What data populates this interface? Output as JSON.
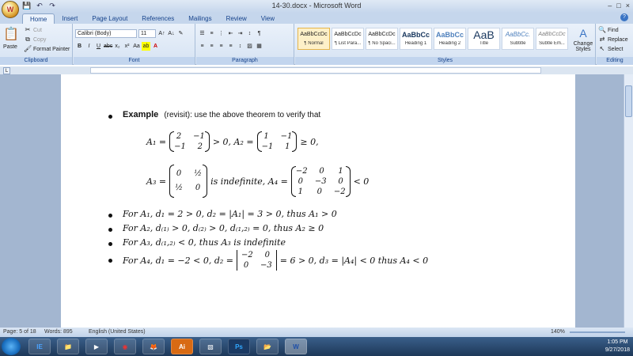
{
  "window": {
    "title": "14-30.docx - Microsoft Word",
    "controls": [
      "–",
      "□",
      "×"
    ]
  },
  "tabs": [
    "Home",
    "Insert",
    "Page Layout",
    "References",
    "Mailings",
    "Review",
    "View"
  ],
  "clipboard": {
    "paste": "Paste",
    "cut": "Cut",
    "copy": "Copy",
    "format_painter": "Format Painter",
    "label": "Clipboard"
  },
  "font": {
    "name": "Calibri (Body)",
    "size": "11",
    "label": "Font"
  },
  "paragraph": {
    "label": "Paragraph"
  },
  "styles": {
    "label": "Styles",
    "items": [
      {
        "preview": "AaBbCcDc",
        "name": "¶ Normal"
      },
      {
        "preview": "AaBbCcDc",
        "name": "¶ List Para..."
      },
      {
        "preview": "AaBbCcDc",
        "name": "¶ No Spaci..."
      },
      {
        "preview": "AaBbCc",
        "name": "Heading 1"
      },
      {
        "preview": "AaBbCc",
        "name": "Heading 2"
      },
      {
        "preview": "AaB",
        "name": "Title"
      },
      {
        "preview": "AaBbCc.",
        "name": "Subtitle"
      },
      {
        "preview": "AaBbCcDc",
        "name": "Subtle Em..."
      }
    ],
    "change_styles": "Change Styles"
  },
  "editing": {
    "find": "Find",
    "replace": "Replace",
    "select": "Select",
    "label": "Editing"
  },
  "doc": {
    "example_bold": "Example",
    "example_rest": "(revisit): use the above theorem to verify that",
    "a1_label": "A₁ =",
    "a1": [
      [
        "2",
        "−1"
      ],
      [
        "−1",
        "2"
      ]
    ],
    "a1_rel": "> 0, A₂ =",
    "a2": [
      [
        "1",
        "−1"
      ],
      [
        "−1",
        "1"
      ]
    ],
    "a2_rel": "≥ 0,",
    "a3_label": "A₃ =",
    "a3": [
      [
        "0",
        "½"
      ],
      [
        "½",
        "0"
      ]
    ],
    "a3_rel": "is indefinite, A₄ =",
    "a4": [
      [
        "−2",
        "0",
        "1"
      ],
      [
        "0",
        "−3",
        "0"
      ],
      [
        "1",
        "0",
        "−2"
      ]
    ],
    "a4_rel": "< 0",
    "bullets": [
      "For  A₁, d₁ = 2 > 0, d₂ = |A₁| = 3 > 0, thus A₁ > 0",
      "For  A₂, d₍₁₎ > 0, d₍₂₎ > 0, d₍₁,₂₎ = 0, thus A₂ ≥ 0",
      "For  A₃, d₍₁,₂₎ < 0, thus A₃ is indefinite"
    ],
    "b4_pre": "For  A₄, d₁ = −2 < 0, d₂ =",
    "b4_det": [
      [
        "−2",
        "0"
      ],
      [
        "0",
        "−3"
      ]
    ],
    "b4_post": "= 6 > 0, d₃ = |A₄| < 0 thus A₄ < 0"
  },
  "status": {
    "page": "Page: 5 of 18",
    "words": "Words: 895",
    "language": "English (United States)",
    "zoom": "140%"
  },
  "taskbar": {
    "apps": [
      "IE",
      "📁",
      "▶",
      "◉",
      "🦊",
      "Ai",
      "▧",
      "Ps",
      "📂",
      "W"
    ],
    "time": "1:05 PM",
    "date": "9/27/2018"
  }
}
